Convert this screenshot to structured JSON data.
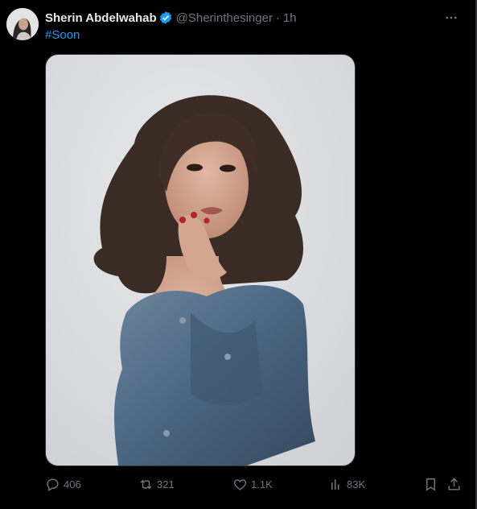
{
  "tweet": {
    "author_name": "Sherin Abdelwahab",
    "handle": "@Sherinthesinger",
    "separator": "·",
    "time": "1h",
    "text": "#Soon"
  },
  "actions": {
    "replies": "406",
    "retweets": "321",
    "likes": "1.1K",
    "views": "83K"
  },
  "icons": {
    "verified": "verified-badge-icon",
    "more": "more-options-icon",
    "reply": "reply-icon",
    "retweet": "retweet-icon",
    "like": "heart-icon",
    "views": "views-chart-icon",
    "bookmark": "bookmark-icon",
    "share": "share-icon"
  },
  "colors": {
    "background": "#000000",
    "link": "#1d9bf0",
    "muted": "#71767b",
    "text": "#e7e9ea"
  }
}
